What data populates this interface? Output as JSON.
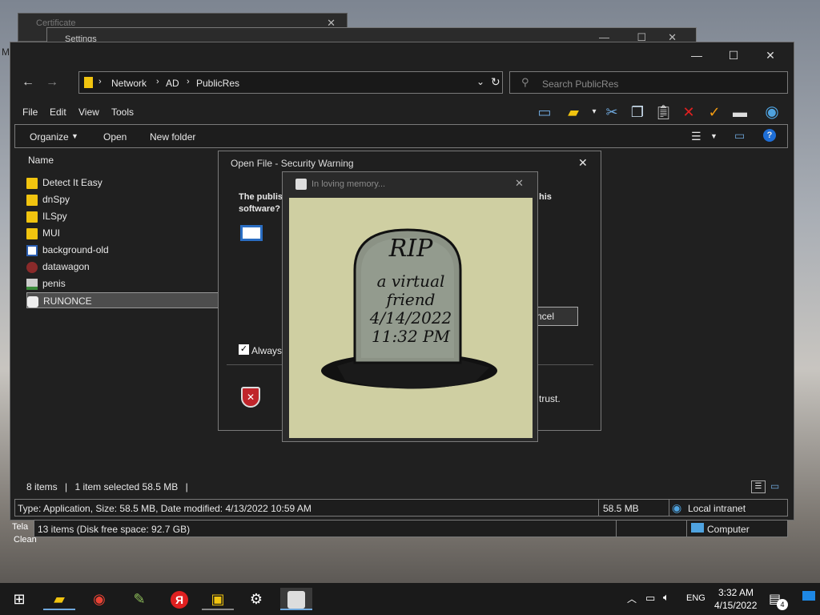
{
  "background_windows": {
    "certificate_title": "Certificate",
    "settings_title": "Settings"
  },
  "explorer": {
    "address": {
      "parts": [
        "Network",
        "AD",
        "PublicRes"
      ]
    },
    "search_placeholder": "Search PublicRes",
    "menu": [
      "File",
      "Edit",
      "View",
      "Tools"
    ],
    "commands": {
      "organize": "Organize",
      "open": "Open",
      "new_folder": "New folder"
    },
    "column_name": "Name",
    "files": [
      {
        "name": "Detect It Easy",
        "icon": "folder-icon"
      },
      {
        "name": "dnSpy",
        "icon": "folder-icon"
      },
      {
        "name": "ILSpy",
        "icon": "folder-icon"
      },
      {
        "name": "MUI",
        "icon": "folder-icon"
      },
      {
        "name": "background-old",
        "icon": "document-icon"
      },
      {
        "name": "datawagon",
        "icon": "app-icon"
      },
      {
        "name": "penis",
        "icon": "image-icon"
      },
      {
        "name": "RUNONCE",
        "icon": "bunny-icon"
      }
    ],
    "status": {
      "items": "8 items",
      "selected": "1 item selected  58.5 MB"
    },
    "info": {
      "details": "Type: Application, Size: 58.5 MB, Date modified: 4/13/2022 10:59 AM",
      "size": "58.5 MB",
      "zone": "Local intranet"
    },
    "info2": {
      "items": "13 items (Disk free space: 92.7 GB)",
      "location": "Computer"
    }
  },
  "security_warning": {
    "title": "Open File - Security Warning",
    "question_left": "The publis",
    "question_right": "his",
    "question_line2": "software?",
    "cancel_partial": "ncel",
    "always_partial": "Always",
    "trust_partial": "trust."
  },
  "memorial": {
    "title": "In loving memory...",
    "rip": "RIP",
    "line1": "a virtual",
    "line2": "friend",
    "date": "4/14/2022",
    "time": "11:32 PM"
  },
  "taskbar": {
    "language": "ENG",
    "time": "3:32 AM",
    "date": "4/15/2022",
    "notifications": "4"
  },
  "desktop_edge": {
    "left_tela": "Tela",
    "left_clean": "Clean",
    "left_m": "M"
  }
}
